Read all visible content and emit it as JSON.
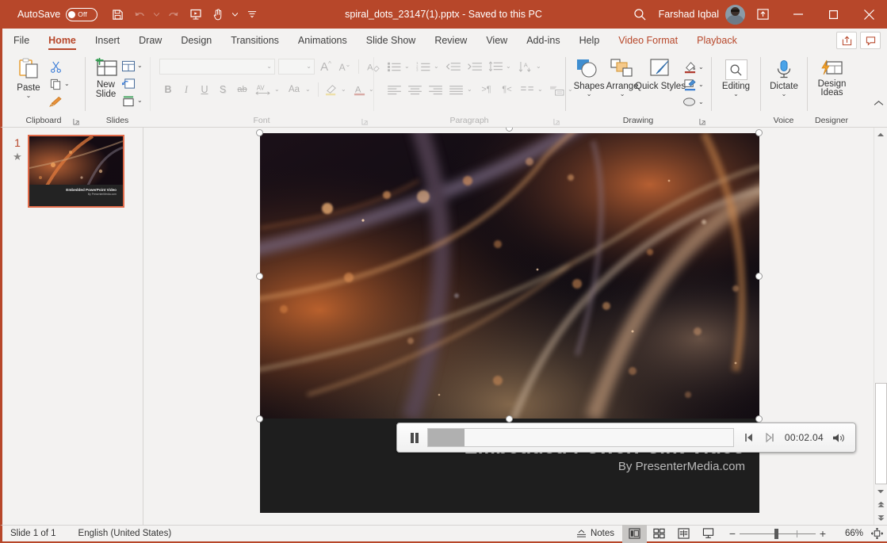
{
  "titlebar": {
    "autosave_label": "AutoSave",
    "autosave_state": "Off",
    "document_title": "spiral_dots_23147(1).pptx  -  Saved to this PC",
    "user_name": "Farshad Iqbal",
    "qat": [
      {
        "name": "save-button",
        "icon": "save-icon"
      },
      {
        "name": "undo-button",
        "icon": "undo-icon"
      },
      {
        "name": "redo-button",
        "icon": "redo-icon"
      },
      {
        "name": "start-from-beginning-button",
        "icon": "slideshow-icon"
      },
      {
        "name": "touch-mode-button",
        "icon": "touch-hand-icon"
      },
      {
        "name": "customize-qat-button",
        "icon": "chevron-down-icon"
      }
    ],
    "window_buttons": [
      "minimize",
      "maximize",
      "close"
    ]
  },
  "tabs": [
    {
      "label": "File",
      "state": "normal"
    },
    {
      "label": "Home",
      "state": "active"
    },
    {
      "label": "Insert",
      "state": "normal"
    },
    {
      "label": "Draw",
      "state": "normal"
    },
    {
      "label": "Design",
      "state": "normal"
    },
    {
      "label": "Transitions",
      "state": "normal"
    },
    {
      "label": "Animations",
      "state": "normal"
    },
    {
      "label": "Slide Show",
      "state": "normal"
    },
    {
      "label": "Review",
      "state": "normal"
    },
    {
      "label": "View",
      "state": "normal"
    },
    {
      "label": "Add-ins",
      "state": "normal"
    },
    {
      "label": "Help",
      "state": "normal"
    },
    {
      "label": "Video Format",
      "state": "contextual"
    },
    {
      "label": "Playback",
      "state": "contextual"
    }
  ],
  "ribbon": {
    "groups": [
      {
        "label": "Clipboard",
        "has_dialog_launcher": true
      },
      {
        "label": "Slides",
        "has_dialog_launcher": false
      },
      {
        "label": "Font",
        "has_dialog_launcher": true
      },
      {
        "label": "Paragraph",
        "has_dialog_launcher": true
      },
      {
        "label": "Drawing",
        "has_dialog_launcher": true
      },
      {
        "label": "Editing",
        "has_dialog_launcher": false
      },
      {
        "label": "Voice",
        "has_dialog_launcher": false
      },
      {
        "label": "Designer",
        "has_dialog_launcher": false
      }
    ],
    "clipboard": {
      "paste_label": "Paste",
      "cut_name": "cut-button",
      "copy_name": "copy-button",
      "format_painter_name": "format-painter-button"
    },
    "slides": {
      "new_slide_label": "New Slide",
      "layout_name": "layout-button",
      "reset_name": "reset-button",
      "section_name": "section-button"
    },
    "font": {
      "font_name_value": "",
      "font_name_placeholder": "",
      "font_size_value": "",
      "increase_size": "A",
      "decrease_size": "A",
      "clear_formatting": "clear-formatting-icon",
      "bold": "B",
      "italic": "I",
      "underline": "U",
      "shadow": "S",
      "strikethrough": "ab",
      "char_spacing": "AV",
      "change_case": "Aa",
      "disabled": true
    },
    "drawing": {
      "shapes_label": "Shapes",
      "arrange_label": "Arrange",
      "quick_styles_label": "Quick Styles"
    },
    "editing": {
      "label": "Editing"
    },
    "voice": {
      "dictate_label": "Dictate"
    },
    "designer": {
      "design_ideas_label": "Design Ideas"
    }
  },
  "thumbnails": [
    {
      "number": "1",
      "star": "★",
      "title": "Embedded PowerPoint Video",
      "subtitle": "By PresenterMedia.com",
      "selected": true
    }
  ],
  "slide": {
    "title": "Embedded PowerPoint Video",
    "subtitle": "By PresenterMedia.com",
    "background": "#1e1e1e",
    "selected": true
  },
  "player": {
    "play_pause": "pause-icon",
    "back_frame": "previous-frame-icon",
    "forward_frame": "next-frame-icon",
    "time": "00:02.04",
    "volume": "volume-icon",
    "progress_percent": 8
  },
  "statusbar": {
    "slide_count": "Slide 1 of 1",
    "language": "English (United States)",
    "notes_label": "Notes",
    "views": [
      {
        "name": "normal-view-button",
        "selected": true
      },
      {
        "name": "slide-sorter-view-button",
        "selected": false
      },
      {
        "name": "reading-view-button",
        "selected": false
      },
      {
        "name": "slide-show-button",
        "selected": false
      }
    ],
    "zoom_out": "−",
    "zoom_in": "+",
    "zoom_level": "66%",
    "fit_to_window": "fit-slide-icon"
  },
  "colors": {
    "accent": "#b7472a",
    "ribbon_bg": "#f3f2f1",
    "selection_border": "#e06a49"
  }
}
